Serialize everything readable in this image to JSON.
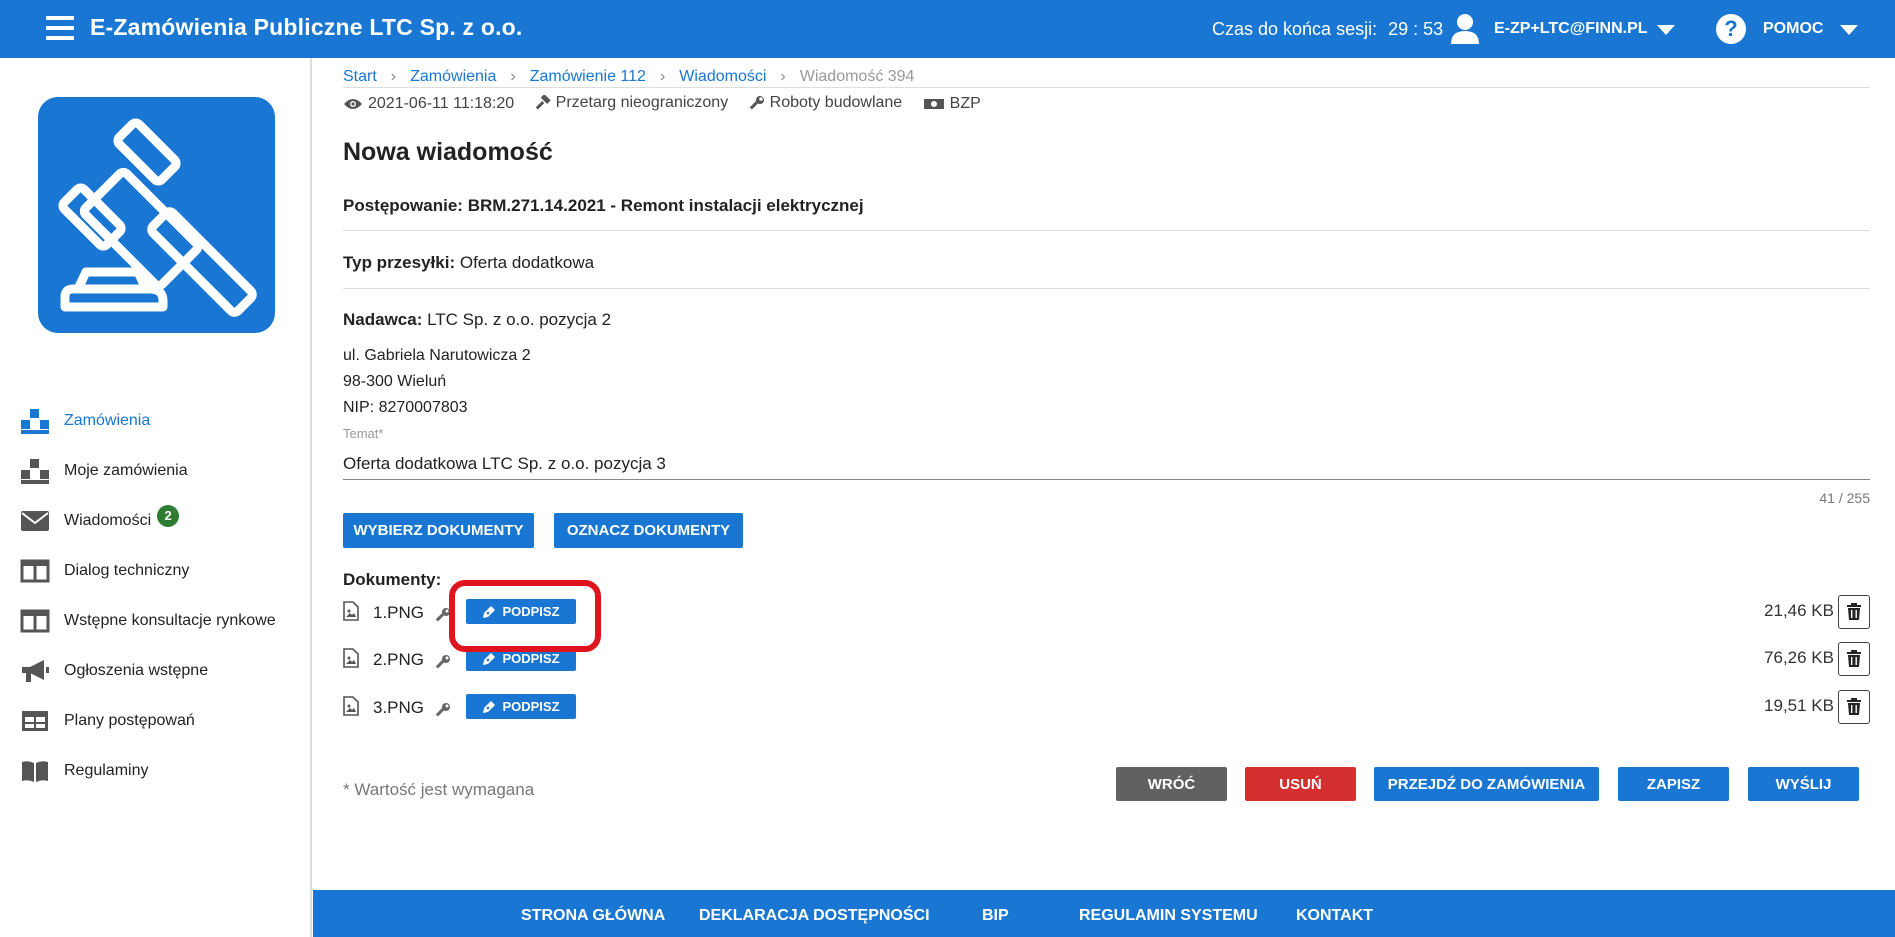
{
  "header": {
    "app_title": "E-Zamówienia Publiczne LTC Sp. z o.o.",
    "session_label": "Czas do końca sesji:",
    "session_timer": "29 : 53",
    "user_email": "E-ZP+LTC@FINN.PL",
    "help_label": "POMOC"
  },
  "sidebar": {
    "items": [
      {
        "label": "Zamówienia",
        "icon": "boxes-icon",
        "active": true
      },
      {
        "label": "Moje zamówienia",
        "icon": "boxes-icon"
      },
      {
        "label": "Wiadomości",
        "icon": "envelope-icon",
        "badge": "2"
      },
      {
        "label": "Dialog techniczny",
        "icon": "columns-icon"
      },
      {
        "label": "Wstępne konsultacje rynkowe",
        "icon": "columns-icon"
      },
      {
        "label": "Ogłoszenia wstępne",
        "icon": "megaphone-icon"
      },
      {
        "label": "Plany postępowań",
        "icon": "table-icon"
      },
      {
        "label": "Regulaminy",
        "icon": "book-icon"
      }
    ]
  },
  "breadcrumb": {
    "items": [
      "Start",
      "Zamówienia",
      "Zamówienie 112",
      "Wiadomości"
    ],
    "current": "Wiadomość 394"
  },
  "meta": {
    "date": "2021-06-11 11:18:20",
    "procedure_type": "Przetarg nieograniczony",
    "category": "Roboty budowlane",
    "notice": "BZP"
  },
  "page_title": "Nowa wiadomość",
  "proceeding": {
    "label": "Postępowanie:",
    "value": "BRM.271.14.2021 - Remont instalacji elektrycznej"
  },
  "shipment_type": {
    "label": "Typ przesyłki:",
    "value": "Oferta dodatkowa"
  },
  "sender": {
    "label": "Nadawca:",
    "value": "LTC Sp. z o.o. pozycja 2",
    "street": "ul. Gabriela Narutowicza 2",
    "city": "98-300 Wieluń",
    "nip": "NIP: 8270007803"
  },
  "subject": {
    "label": "Temat*",
    "value": "Oferta dodatkowa LTC Sp. z o.o. pozycja 3",
    "counter": "41 / 255"
  },
  "doc_buttons": {
    "choose": "WYBIERZ DOKUMENTY",
    "mark": "OZNACZ DOKUMENTY"
  },
  "documents": {
    "label": "Dokumenty:",
    "sign_label": "PODPISZ",
    "items": [
      {
        "name": "1.PNG",
        "size": "21,46 KB"
      },
      {
        "name": "2.PNG",
        "size": "76,26 KB"
      },
      {
        "name": "3.PNG",
        "size": "19,51 KB"
      }
    ]
  },
  "required_note": "* Wartość jest wymagana",
  "actions": {
    "back": "WRÓĆ",
    "delete": "USUŃ",
    "go_to_order": "PRZEJDŹ DO ZAMÓWIENIA",
    "save": "ZAPISZ",
    "send": "WYŚLIJ"
  },
  "footer": {
    "links": [
      "STRONA GŁÓWNA",
      "DEKLARACJA DOSTĘPNOŚCI",
      "BIP",
      "REGULAMIN SYSTEMU",
      "KONTAKT"
    ]
  },
  "colors": {
    "primary": "#1976d2",
    "danger": "#d32f2f",
    "neutral": "#616161",
    "badge": "#2e7d32",
    "highlight": "#e0141e"
  }
}
